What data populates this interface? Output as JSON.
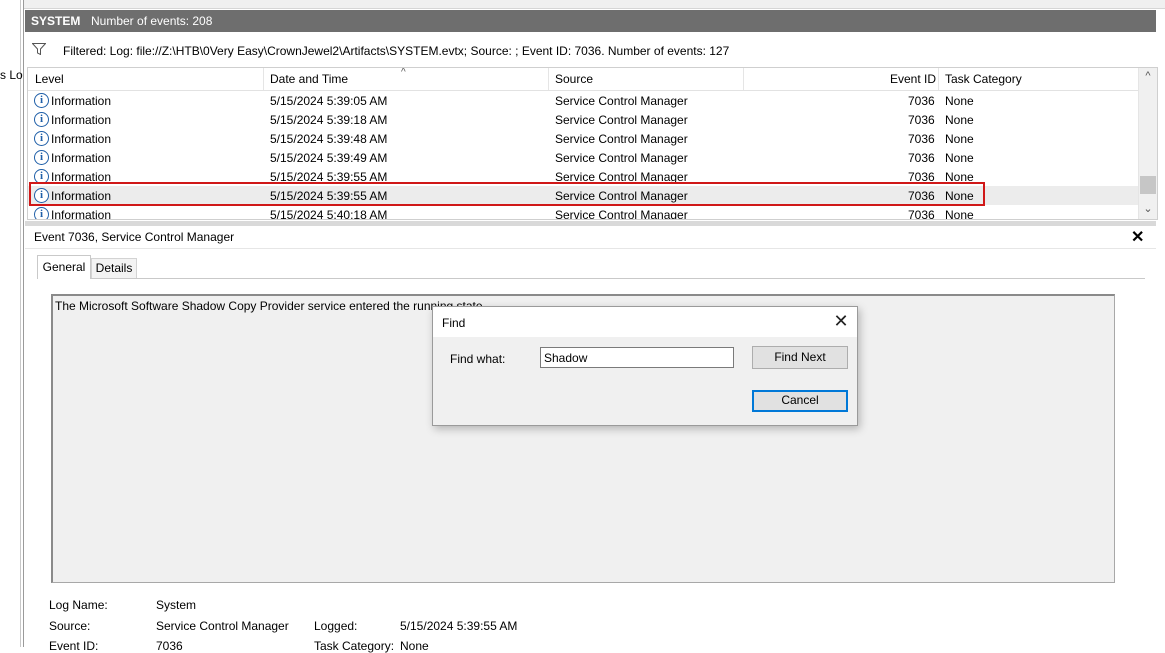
{
  "left_pane": {
    "text": "s Lo"
  },
  "header": {
    "log_name": "SYSTEM",
    "event_count": "Number of events: 208",
    "filter_text": "Filtered: Log: file://Z:\\HTB\\0Very Easy\\CrownJewel2\\Artifacts\\SYSTEM.evtx; Source: ; Event ID: 7036. Number of events: 127"
  },
  "grid": {
    "columns": [
      "Level",
      "Date and Time",
      "Source",
      "Event ID",
      "Task Category"
    ],
    "rows": [
      {
        "level": "Information",
        "date": "5/15/2024 5:39:05 AM",
        "source": "Service Control Manager",
        "event_id": "7036",
        "category": "None"
      },
      {
        "level": "Information",
        "date": "5/15/2024 5:39:18 AM",
        "source": "Service Control Manager",
        "event_id": "7036",
        "category": "None"
      },
      {
        "level": "Information",
        "date": "5/15/2024 5:39:48 AM",
        "source": "Service Control Manager",
        "event_id": "7036",
        "category": "None"
      },
      {
        "level": "Information",
        "date": "5/15/2024 5:39:49 AM",
        "source": "Service Control Manager",
        "event_id": "7036",
        "category": "None"
      },
      {
        "level": "Information",
        "date": "5/15/2024 5:39:55 AM",
        "source": "Service Control Manager",
        "event_id": "7036",
        "category": "None"
      },
      {
        "level": "Information",
        "date": "5/15/2024 5:39:55 AM",
        "source": "Service Control Manager",
        "event_id": "7036",
        "category": "None"
      },
      {
        "level": "Information",
        "date": "5/15/2024 5:40:18 AM",
        "source": "Service Control Manager",
        "event_id": "7036",
        "category": "None"
      }
    ],
    "selected_row": 5,
    "highlight_color": "#d01818",
    "level_icon": "info-icon"
  },
  "detail": {
    "title": "Event 7036, Service Control Manager",
    "tabs": [
      "General",
      "Details"
    ],
    "active_tab": "General",
    "description": "The Microsoft Software Shadow Copy Provider service entered the running state.",
    "fields": {
      "log_name_label": "Log Name:",
      "log_name_value": "System",
      "source_label": "Source:",
      "source_value": "Service Control Manager",
      "logged_label": "Logged:",
      "logged_value": "5/15/2024 5:39:55 AM",
      "event_id_label": "Event ID:",
      "event_id_value": "7036",
      "task_category_label": "Task Category:",
      "task_category_value": "None"
    }
  },
  "find_dialog": {
    "title": "Find",
    "label": "Find what:",
    "value": "Shadow",
    "find_next": "Find Next",
    "cancel": "Cancel"
  }
}
